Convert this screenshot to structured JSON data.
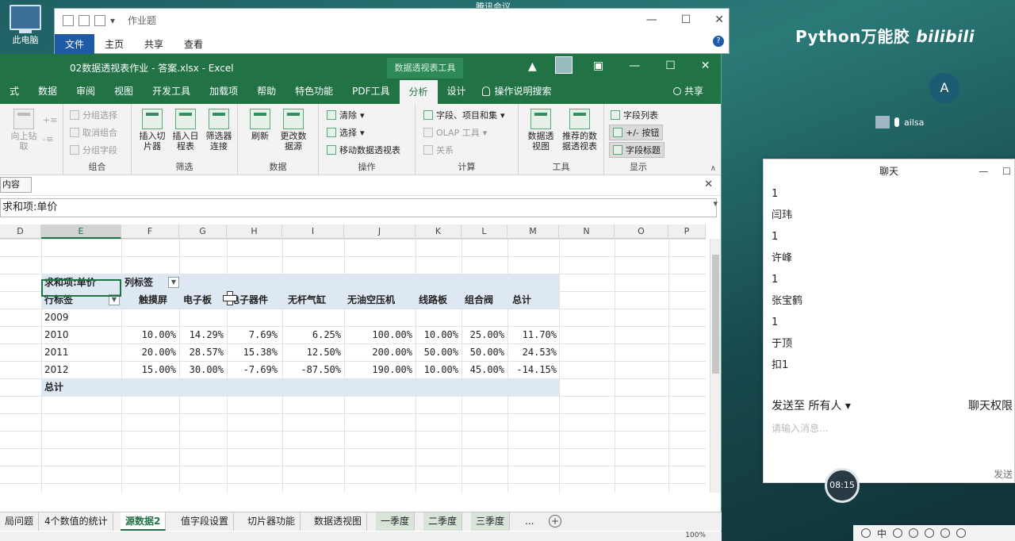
{
  "desktop": {
    "icon_label": "此电脑",
    "brand_text": "Python万能胶",
    "brand_logo": "bilibili",
    "top_app": "腾讯会议",
    "avatar_letter": "A",
    "participant_name": "ailsa"
  },
  "explorer": {
    "title": "作业题",
    "tabs": [
      "文件",
      "主页",
      "共享",
      "查看"
    ],
    "active_tab": "文件"
  },
  "excel": {
    "title": "02数据透视表作业 - 答案.xlsx  -  Excel",
    "context_tool": "数据透视表工具",
    "menu_tabs": [
      "式",
      "数据",
      "审阅",
      "视图",
      "开发工具",
      "加载项",
      "帮助",
      "特色功能",
      "PDF工具",
      "分析",
      "设计"
    ],
    "active_menu_tab": "分析",
    "tell_me": "操作说明搜索",
    "share": "共享",
    "ribbon": {
      "group_move": {
        "btn": "向上钻取"
      },
      "group_combine": {
        "label": "组合",
        "items": [
          "分组选择",
          "取消组合",
          "分组字段"
        ]
      },
      "group_filter": {
        "label": "筛选",
        "buttons": [
          "插入切片器",
          "插入日程表",
          "筛选器连接"
        ]
      },
      "group_data": {
        "label": "数据",
        "buttons": [
          "刷新",
          "更改数据源"
        ]
      },
      "group_ops": {
        "label": "操作",
        "items": [
          "清除",
          "选择",
          "移动数据透视表"
        ]
      },
      "group_calc": {
        "label": "计算",
        "items": [
          "字段、项目和集",
          "OLAP 工具",
          "关系"
        ]
      },
      "group_tools": {
        "label": "工具",
        "buttons": [
          "数据透视图",
          "推荐的数据透视表"
        ]
      },
      "group_show": {
        "label": "显示",
        "items": [
          "字段列表",
          "+/- 按钮",
          "字段标题"
        ]
      }
    },
    "context_box": "内容",
    "formula": "求和项:单价",
    "columns": [
      "D",
      "E",
      "F",
      "G",
      "H",
      "I",
      "J",
      "K",
      "L",
      "M",
      "N",
      "O",
      "P"
    ],
    "selected_column": "E",
    "pivot": {
      "value_field": "求和项:单价",
      "col_label": "列标签",
      "row_label": "行标签",
      "headers": [
        "触摸屏",
        "电子板",
        "电子器件",
        "无杆气缸",
        "无油空压机",
        "线路板",
        "组合阀",
        "总计"
      ],
      "rows": [
        {
          "year": "2009",
          "values": [
            "",
            "",
            "",
            "",
            "",
            "",
            "",
            ""
          ]
        },
        {
          "year": "2010",
          "values": [
            "10.00%",
            "14.29%",
            "7.69%",
            "6.25%",
            "100.00%",
            "10.00%",
            "25.00%",
            "11.70%"
          ]
        },
        {
          "year": "2011",
          "values": [
            "20.00%",
            "28.57%",
            "15.38%",
            "12.50%",
            "200.00%",
            "50.00%",
            "50.00%",
            "24.53%"
          ]
        },
        {
          "year": "2012",
          "values": [
            "15.00%",
            "30.00%",
            "-7.69%",
            "-87.50%",
            "190.00%",
            "10.00%",
            "45.00%",
            "-14.15%"
          ]
        }
      ],
      "grand_total": "总计"
    },
    "sheet_tabs": [
      "局问题",
      "4个数值的统计",
      "源数据2",
      "值字段设置",
      "切片器功能",
      "数据透视图",
      "一季度",
      "二季度",
      "三季度",
      "..."
    ],
    "active_sheet": "源数据2",
    "zoom": "100%"
  },
  "chat": {
    "title": "聊天",
    "messages": [
      "1",
      "闫玮",
      "1",
      "许峰",
      "1",
      "张宝鹤",
      "1",
      "于顶",
      "扣1"
    ],
    "send_to": "发送至 所有人",
    "permission": "聊天权限",
    "placeholder": "请输入消息...",
    "send": "发送",
    "time": "08:15"
  },
  "taskbar": {
    "ime": "中"
  }
}
